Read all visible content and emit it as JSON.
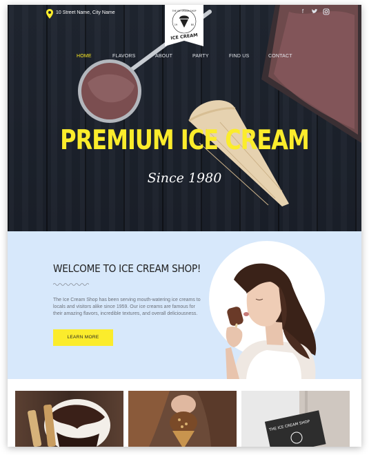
{
  "header": {
    "address": "10 Street Name, City Name",
    "logo": {
      "arc_text": "THE ICE CREAM SHOP",
      "years": [
        "19",
        "80"
      ],
      "name": "ICE CREAM"
    },
    "social_icons": [
      "facebook-icon",
      "twitter-icon",
      "instagram-icon"
    ]
  },
  "nav": {
    "items": [
      "HOME",
      "FLAVORS",
      "ABOUT",
      "PARTY",
      "FIND US",
      "CONTACT"
    ],
    "active": "HOME",
    "active_color": "#ffee22"
  },
  "hero": {
    "title": "PREMIUM ICE CREAM",
    "subtitle": "Since 1980",
    "title_color": "#fbec2c"
  },
  "welcome": {
    "title": "WELCOME TO ICE CREAM SHOP!",
    "text": "The Ice Cream Shop has been serving mouth-watering ice creams to locals and visitors alike since 1959. Our ice creams are famous for their amazing flavors, incredible textures, and overall deliciousness.",
    "button": "LEARN MORE",
    "bg_color": "#d7e8fb",
    "button_color": "#fbec2c"
  },
  "gallery": {
    "sign_text": "THE ICE CREAM SHOP"
  }
}
